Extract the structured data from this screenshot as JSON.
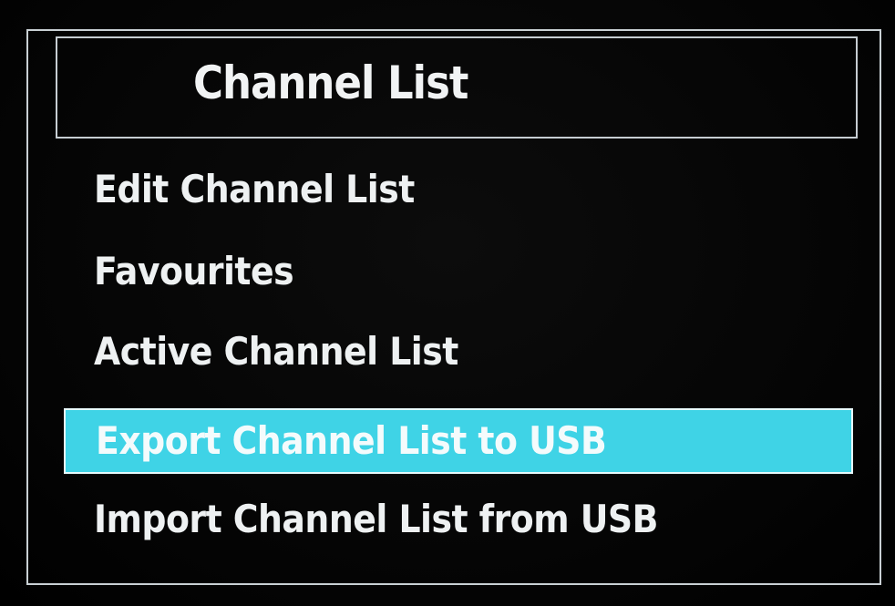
{
  "menu": {
    "title": "Channel List",
    "items": [
      {
        "label": "Edit Channel List",
        "selected": false
      },
      {
        "label": "Favourites",
        "selected": false
      },
      {
        "label": "Active Channel List",
        "selected": false
      },
      {
        "label": "Export Channel List to USB",
        "selected": true
      },
      {
        "label": "Import Channel List from USB",
        "selected": false
      }
    ]
  },
  "colors": {
    "background": "#050505",
    "frame": "#c9d0d4",
    "text": "#eef1f2",
    "highlight": "#3fd3e6"
  }
}
